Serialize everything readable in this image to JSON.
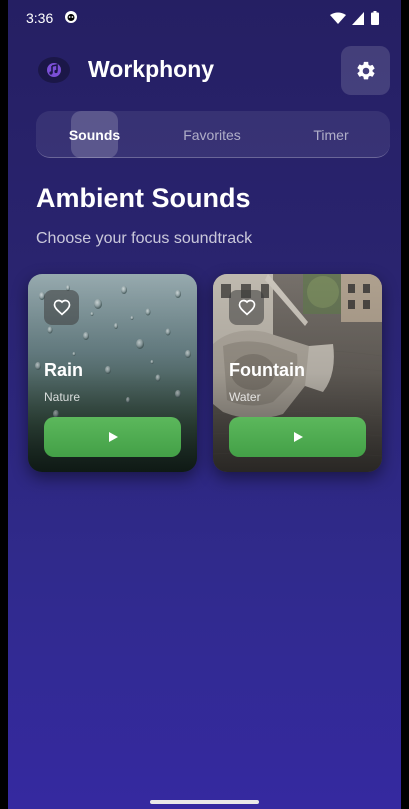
{
  "status_bar": {
    "time": "3:36"
  },
  "app": {
    "title": "Workphony"
  },
  "tabs": [
    {
      "label": "Sounds",
      "active": true
    },
    {
      "label": "Favorites",
      "active": false
    },
    {
      "label": "Timer",
      "active": false
    }
  ],
  "section": {
    "title": "Ambient Sounds",
    "subtitle": "Choose your focus soundtrack"
  },
  "sounds": [
    {
      "name": "Rain",
      "category": "Nature",
      "favorite_icon": "heart-outline-icon",
      "play_icon": "play-icon"
    },
    {
      "name": "Fountain",
      "category": "Water",
      "favorite_icon": "heart-outline-icon",
      "play_icon": "play-icon"
    }
  ],
  "colors": {
    "background_top": "#251f63",
    "background_bottom": "#3529a0",
    "play_button": "#4caf50"
  }
}
